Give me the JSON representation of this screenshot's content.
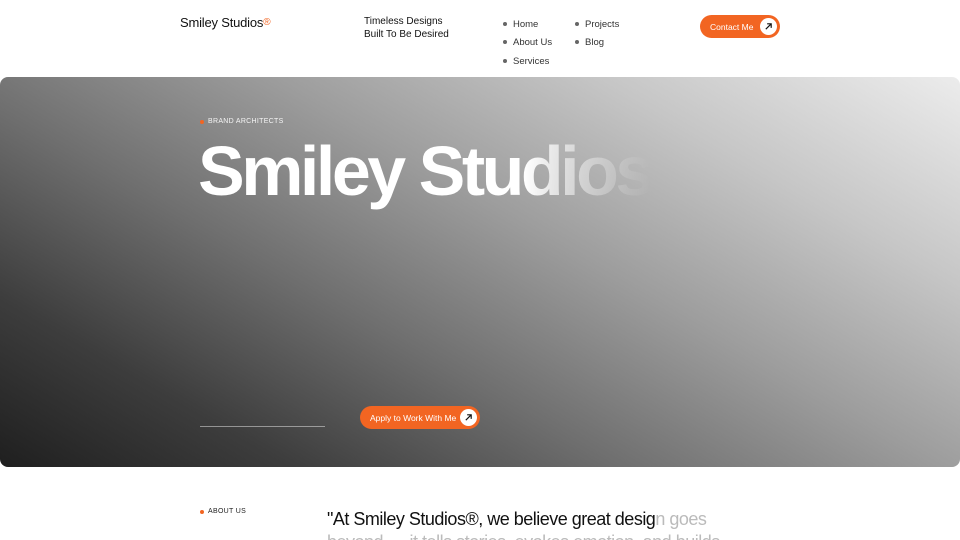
{
  "header": {
    "brand": "Smiley Studios",
    "brand_mark": "®",
    "tagline_line1": "Timeless Designs",
    "tagline_line2": "Built To Be Desired",
    "nav": [
      {
        "label": "Home"
      },
      {
        "label": "About Us"
      },
      {
        "label": "Services"
      },
      {
        "label": "Projects"
      },
      {
        "label": "Blog"
      }
    ],
    "contact_label": "Contact Me",
    "contact_icon": "arrow-up-right-icon"
  },
  "hero": {
    "eyebrow": "BRAND ARCHITECTS",
    "title": "Smiley Studios",
    "apply_label": "Apply to Work With Me",
    "apply_icon": "arrow-up-right-icon"
  },
  "about": {
    "label": "ABOUT US",
    "quote_dark": "\"At Smiley Studios®, we believe great desig",
    "quote_light": "n goes beyond — it tells stories, evokes emotion, and builds"
  },
  "colors": {
    "accent": "#f26522",
    "text_dark": "#111111",
    "text_muted": "#bbbbbb"
  }
}
